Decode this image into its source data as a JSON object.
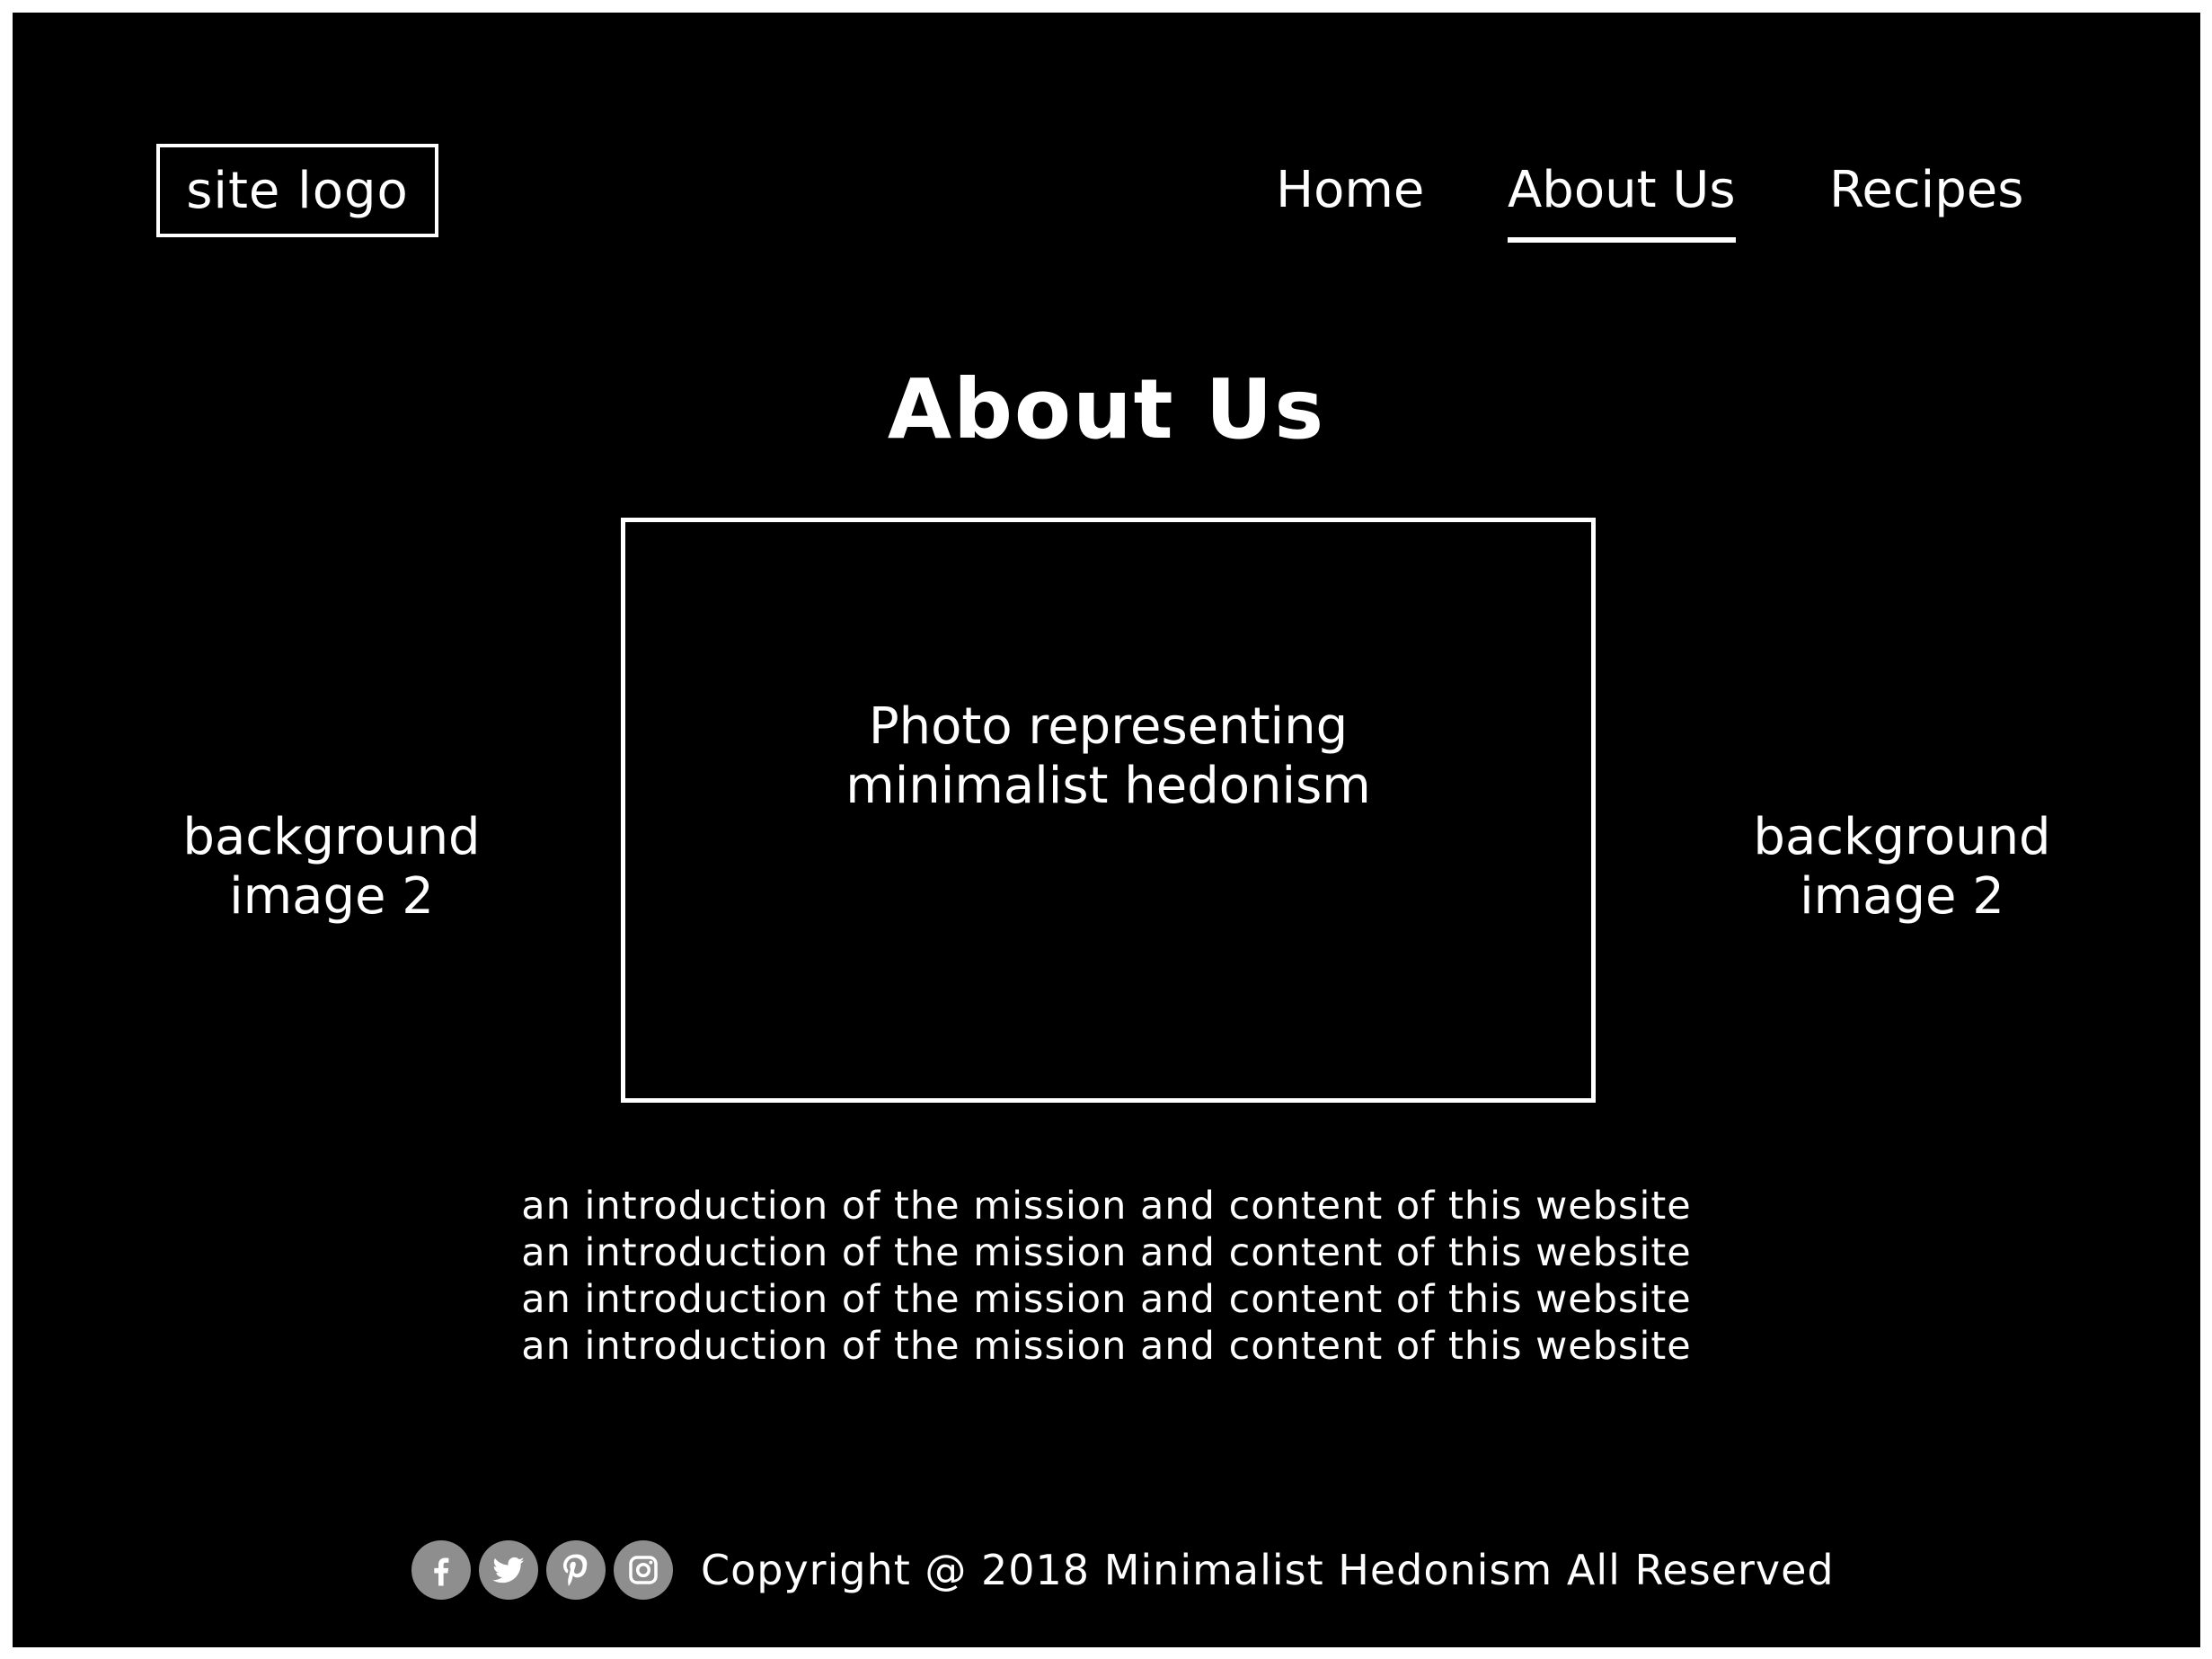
{
  "header": {
    "logo_label": "site logo",
    "nav": {
      "home": "Home",
      "about": "About Us",
      "recipes": "Recipes"
    },
    "active_nav": "About Us"
  },
  "main": {
    "title": "About Us",
    "side_left_line1": "background",
    "side_left_line2": "image 2",
    "side_right_line1": "background",
    "side_right_line2": "image 2",
    "photo_line1": "Photo representing",
    "photo_line2": "minimalist hedonism",
    "intro_lines": [
      "an introduction of the mission and content of this website",
      "an introduction of the mission and content of this website",
      "an introduction of the mission and content of this website",
      "an introduction of the mission and content of this website"
    ]
  },
  "footer": {
    "social_icons": [
      "facebook-icon",
      "twitter-icon",
      "pinterest-icon",
      "instagram-icon"
    ],
    "copyright": "Copyright @ 2018 Minimalist Hedonism All Reserved"
  },
  "colors": {
    "background": "#000000",
    "text": "#ffffff",
    "social_icon_bg": "#8e8e8e"
  }
}
